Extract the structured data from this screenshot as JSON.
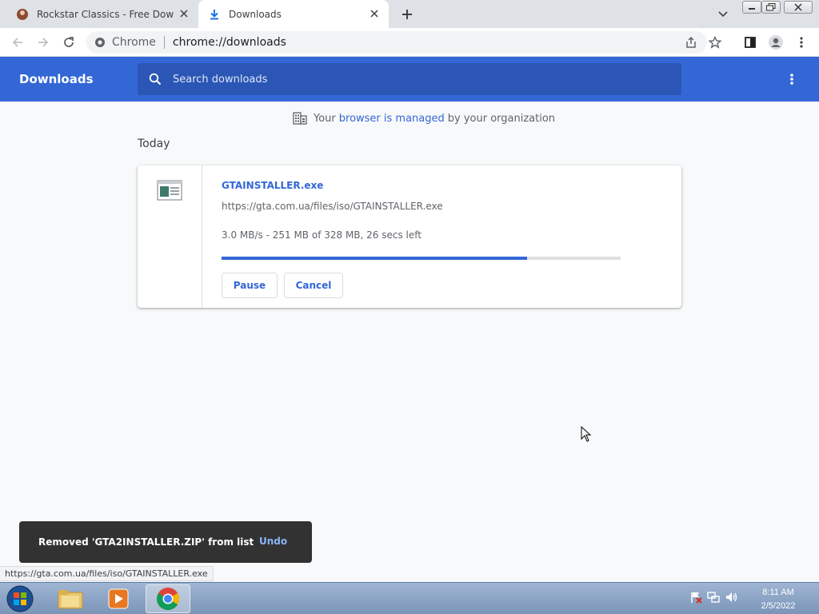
{
  "tabs": [
    {
      "label": "Rockstar Classics - Free Downloa",
      "icon": "rockstar-favicon"
    },
    {
      "label": "Downloads",
      "icon": "download-icon"
    }
  ],
  "omnibox": {
    "site_label": "Chrome",
    "url": "chrome://downloads"
  },
  "header": {
    "title": "Downloads",
    "search_placeholder": "Search downloads"
  },
  "managed": {
    "prefix": "Your",
    "link": "browser is managed",
    "suffix": "by your organization"
  },
  "section_label": "Today",
  "download": {
    "filename": "GTAINSTALLER.exe",
    "url": "https://gta.com.ua/files/iso/GTAINSTALLER.exe",
    "status": "3.0 MB/s - 251 MB of 328 MB, 26 secs left",
    "progress_fraction": 0.765,
    "pause_label": "Pause",
    "cancel_label": "Cancel"
  },
  "toast": {
    "message": "Removed 'GTA2INSTALLER.ZIP' from list",
    "undo_label": "Undo"
  },
  "status_url": "https://gta.com.ua/files/iso/GTAINSTALLER.exe",
  "clock": {
    "time": "8:11 AM",
    "date": "2/5/2022"
  },
  "colors": {
    "accent": "#3367d6",
    "header_bg": "#3367d6",
    "toast_bg": "#323232"
  }
}
